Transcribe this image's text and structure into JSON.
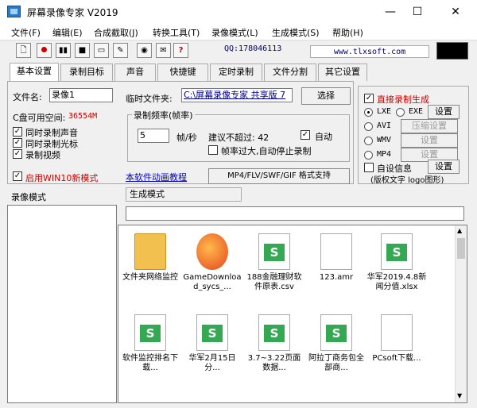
{
  "window": {
    "title": "屏幕录像专家 V2019",
    "controls": {
      "minimize": "—",
      "maximize": "☐",
      "close": "✕"
    }
  },
  "menu": [
    "文件(F)",
    "编辑(E)",
    "合成截取(J)",
    "转换工具(T)",
    "录像模式(L)",
    "生成模式(S)",
    "帮助(H)"
  ],
  "toolbar": {
    "qq": "QQ:178046113",
    "site": "www.tlxsoft.com"
  },
  "tabs": [
    "基本设置",
    "录制目标",
    "声音",
    "快捷键",
    "定时录制",
    "文件分割",
    "其它设置"
  ],
  "basic": {
    "filename_label": "文件名:",
    "filename_value": "录像1",
    "tempdir_label": "临时文件夹:",
    "tempdir_value": "C:\\屏幕录像专家 共享版 7",
    "browse_btn": "选择",
    "disk_label": "C盘可用空间:",
    "disk_value": "36554M",
    "chk_audio": "同时录制声音",
    "chk_cursor": "同时录制光标",
    "chk_video": "录制视频",
    "chk_win10": "启用WIN10新模式",
    "framerate_group": "录制频率(帧率)",
    "framerate_value": "5",
    "framerate_unit": "帧/秒",
    "suggest": "建议不超过: 42",
    "auto": "自动",
    "auto_stop": "帧率过大,自动停止录制",
    "tutorial_link": "本软件动画教程",
    "format_btn": "MP4/FLV/SWF/GIF  格式支持"
  },
  "right": {
    "direct": "直接录制生成",
    "lxe": "LXE",
    "exe": "EXE",
    "setting": "设置",
    "avi": "AVI",
    "compress": "压缩设置",
    "wmv": "WMV",
    "setting2": "设置",
    "mp4": "MP4",
    "setting3": "设置",
    "custom": "自设信息",
    "setting4": "设置",
    "watermark": "(版权文字 logo图形)"
  },
  "bottom": {
    "record_mode": "录像模式",
    "generate_mode": "生成模式"
  },
  "files": [
    {
      "name": "文件夹​网络监控",
      "type": "folder"
    },
    {
      "name": "GameDownload_sycs_...",
      "type": "game"
    },
    {
      "name": "188金融理财软件原表.csv",
      "type": "xls"
    },
    {
      "name": "123.amr",
      "type": "doc"
    },
    {
      "name": "华军2019.4.8新闻分值.xlsx",
      "type": "xls"
    },
    {
      "name": "软件监控排名下载...",
      "type": "xls"
    },
    {
      "name": "华军2月15日分...",
      "type": "xls"
    },
    {
      "name": "3.7~3.22页面数据...",
      "type": "xls"
    },
    {
      "name": "阿拉丁商务包全部商...",
      "type": "xls"
    },
    {
      "name": "PCsoft下载...",
      "type": "doc"
    }
  ]
}
